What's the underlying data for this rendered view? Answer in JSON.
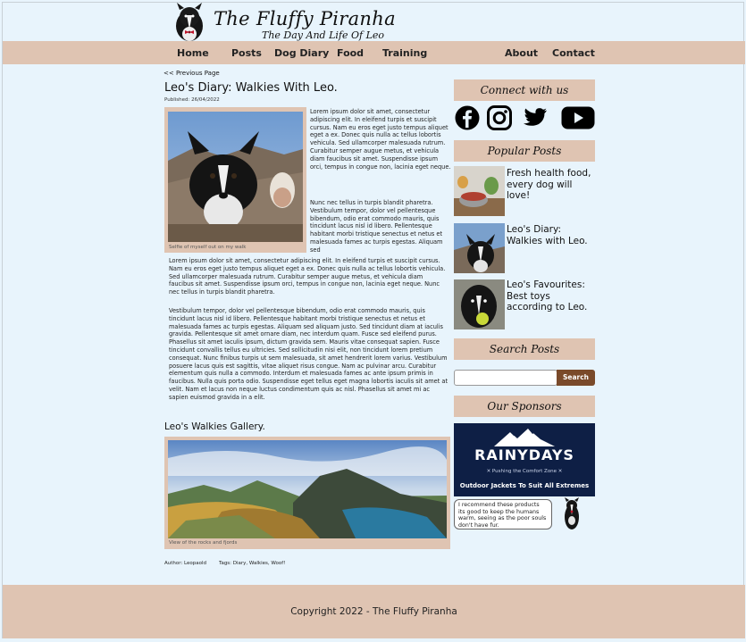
{
  "header": {
    "title": "The Fluffy Piranha",
    "subtitle": "The Day And Life Of Leo"
  },
  "nav": {
    "items": [
      "Home",
      "Posts",
      "Dog Diary",
      "Food",
      "Training",
      "About",
      "Contact"
    ]
  },
  "post": {
    "prev_link": "<< Previous Page",
    "title": "Leo's Diary: Walkies With Leo.",
    "published": "Published: 26/04/2022",
    "photo_caption": "Selfie of myself out on my walk",
    "para1": "Lorem ipsum dolor sit amet, consectetur adipiscing elit. In eleifend turpis et suscipit cursus. Nam eu eros eget justo tempus aliquet eget a ex. Donec quis nulla ac tellus lobortis vehicula. Sed ullamcorper malesuada rutrum. Curabitur semper augue metus, et vehicula diam faucibus sit amet. Suspendisse ipsum orci, tempus in congue non, lacinia eget neque.",
    "para2": "Nunc nec tellus in turpis blandit pharetra. Vestibulum tempor, dolor vel pellentesque bibendum, odio erat commodo mauris, quis tincidunt lacus nisl id libero. Pellentesque habitant morbi tristique senectus et netus et malesuada fames ac turpis egestas. Aliquam sed",
    "para3": "Lorem ipsum dolor sit amet, consectetur adipiscing elit. In eleifend turpis et suscipit cursus. Nam eu eros eget justo tempus aliquet eget a ex. Donec quis nulla ac tellus lobortis vehicula. Sed ullamcorper malesuada rutrum. Curabitur semper augue metus, et vehicula diam faucibus sit amet. Suspendisse ipsum orci, tempus in congue non, lacinia eget neque. Nunc nec tellus in turpis blandit pharetra.",
    "para4": "Vestibulum tempor, dolor vel pellentesque bibendum, odio erat commodo mauris, quis tincidunt lacus nisl id libero. Pellentesque habitant morbi tristique senectus et netus et malesuada fames ac turpis egestas. Aliquam sed aliquam justo. Sed tincidunt diam at iaculis gravida. Pellentesque sit amet ornare diam, nec interdum quam. Fusce sed eleifend purus. Phasellus sit amet iaculis ipsum, dictum gravida sem. Mauris vitae consequat sapien. Fusce tincidunt convallis tellus eu ultricies. Sed sollicitudin nisi elit, non tincidunt lorem pretium consequat. Nunc finibus turpis ut sem malesuada, sit amet hendrerit lorem varius. Vestibulum posuere lacus quis est sagittis, vitae aliquet risus congue. Nam ac pulvinar arcu. Curabitur elementum quis nulla a commodo. Interdum et malesuada fames ac ante ipsum primis in faucibus. Nulla quis porta odio. Suspendisse eget tellus eget magna lobortis iaculis sit amet at velit. Nam et lacus non neque luctus condimentum quis ac nisl. Phasellus sit amet mi ac sapien euismod gravida in a elit.",
    "gallery_title": "Leo's Walkies Gallery.",
    "gallery_caption": "View of the rocks and fjords",
    "author": "Author: Leopaold",
    "tags": "Tags: Diary, Walkies, Woof!"
  },
  "sidebar": {
    "connect_title": "Connect with us",
    "social_icons": [
      "facebook-icon",
      "instagram-icon",
      "twitter-icon",
      "youtube-icon"
    ],
    "popular_title": "Popular Posts",
    "popular": [
      "Fresh health food, every dog will love!",
      "Leo's Diary: Walkies with Leo.",
      "Leo's Favourites: Best toys according to Leo."
    ],
    "search_title": "Search Posts",
    "search_placeholder": "",
    "search_button": "Search",
    "sponsors_title": "Our Sponsors",
    "sponsor_name": "RAINYDAYS",
    "sponsor_tagline": "✕ Pushing the Comfort Zone ✕",
    "sponsor_cta": "Outdoor Jackets To Suit All Extremes",
    "recommend_text": "I recommend these products its good to keep the humans warm, seeing as the poor souls don't have fur."
  },
  "footer": {
    "copyright": "Copyright 2022 - The Fluffy Piranha"
  },
  "colors": {
    "background": "#e8f4fc",
    "accent_tan": "#dfc4b2",
    "search_button": "#7a4a2a",
    "sponsor_navy": "#0e1f45"
  }
}
